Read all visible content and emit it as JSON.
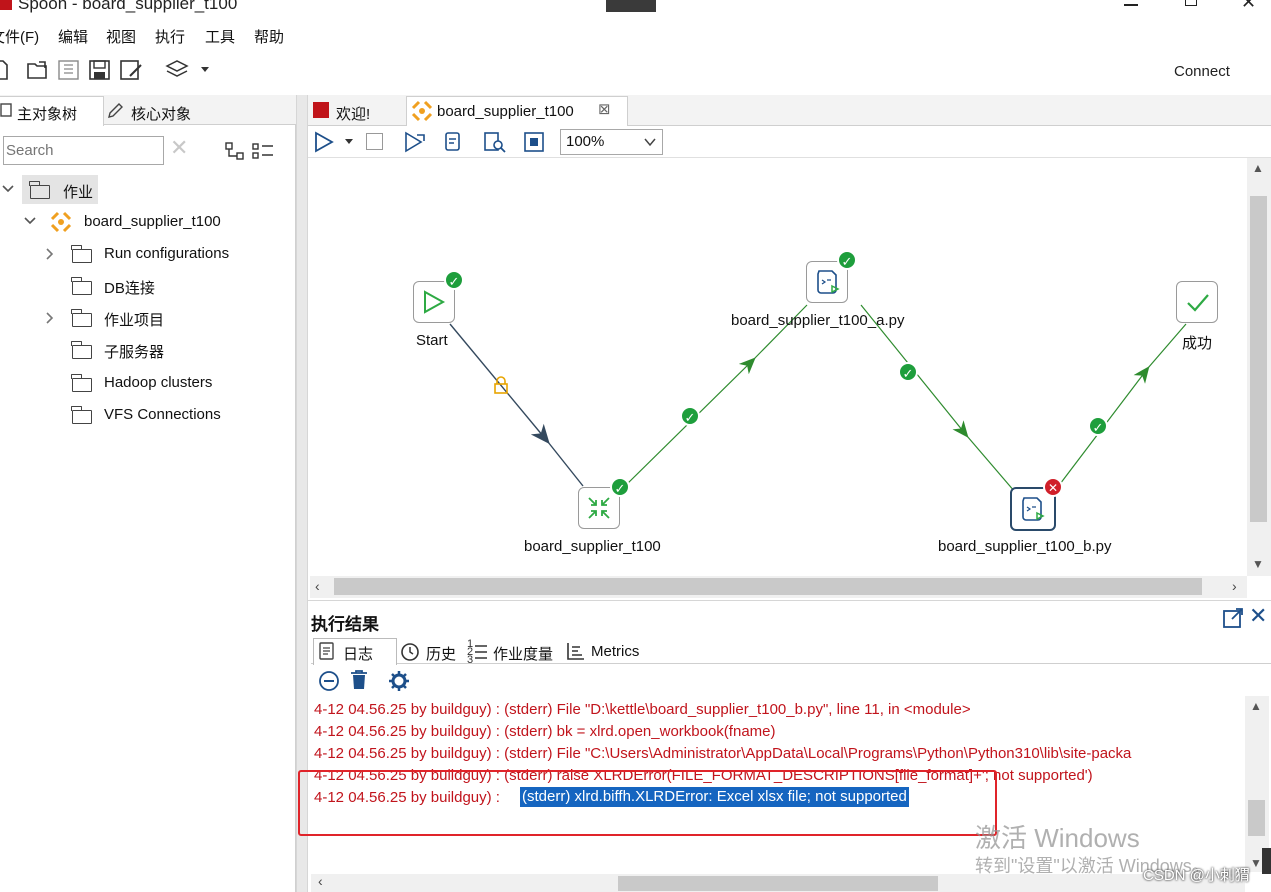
{
  "window": {
    "title": "Spoon - board_supplier_t100"
  },
  "menu": [
    "文件(F)",
    "编辑",
    "视图",
    "执行",
    "工具",
    "帮助"
  ],
  "toolbar": {
    "connect_label": "Connect"
  },
  "left_tabs": [
    "主对象树",
    "核心对象"
  ],
  "search": {
    "placeholder": "Search"
  },
  "tree": {
    "root": "作业",
    "job": "board_supplier_t100",
    "children": [
      "Run configurations",
      "DB连接",
      "作业项目",
      "子服务器",
      "Hadoop clusters",
      "VFS Connections"
    ]
  },
  "editor_tabs": [
    "欢迎!",
    "board_supplier_t100"
  ],
  "zoom": {
    "value": "100%"
  },
  "nodes": {
    "start": "Start",
    "job": "board_supplier_t100",
    "py_a": "board_supplier_t100_a.py",
    "py_b": "board_supplier_t100_b.py",
    "success": "成功"
  },
  "results": {
    "title": "执行结果",
    "tabs": [
      "日志",
      "历史",
      "作业度量",
      "Metrics"
    ]
  },
  "log": {
    "lines": [
      "4-12 04.56.25 by buildguy) : (stderr)   File \"D:\\kettle\\board_supplier_t100_b.py\", line 11, in <module>",
      "4-12 04.56.25 by buildguy) : (stderr)     bk = xlrd.open_workbook(fname)",
      "4-12 04.56.25 by buildguy) : (stderr)   File \"C:\\Users\\Administrator\\AppData\\Local\\Programs\\Python\\Python310\\lib\\site-packa",
      "4-12 04.56.25 by buildguy) : (stderr)     raise XLRDError(FILE_FORMAT_DESCRIPTIONS[file_format]+'; not supported')"
    ],
    "last_prefix": "4-12 04.56.25 by buildguy) : ",
    "last_selected": "(stderr) xlrd.biffh.XLRDError: Excel xlsx file; not supported"
  },
  "watermark": {
    "line1": "激活 Windows",
    "line2": "转到\"设置\"以激活 Windows。",
    "csdn": "CSDN @小刺猬"
  },
  "colors": {
    "ok": "#1e9e3c",
    "error": "#d0202a",
    "log_text": "#c1141c",
    "highlight": "#1565c0",
    "annotation": "#e0242a",
    "hop": "#2e8b2e"
  }
}
